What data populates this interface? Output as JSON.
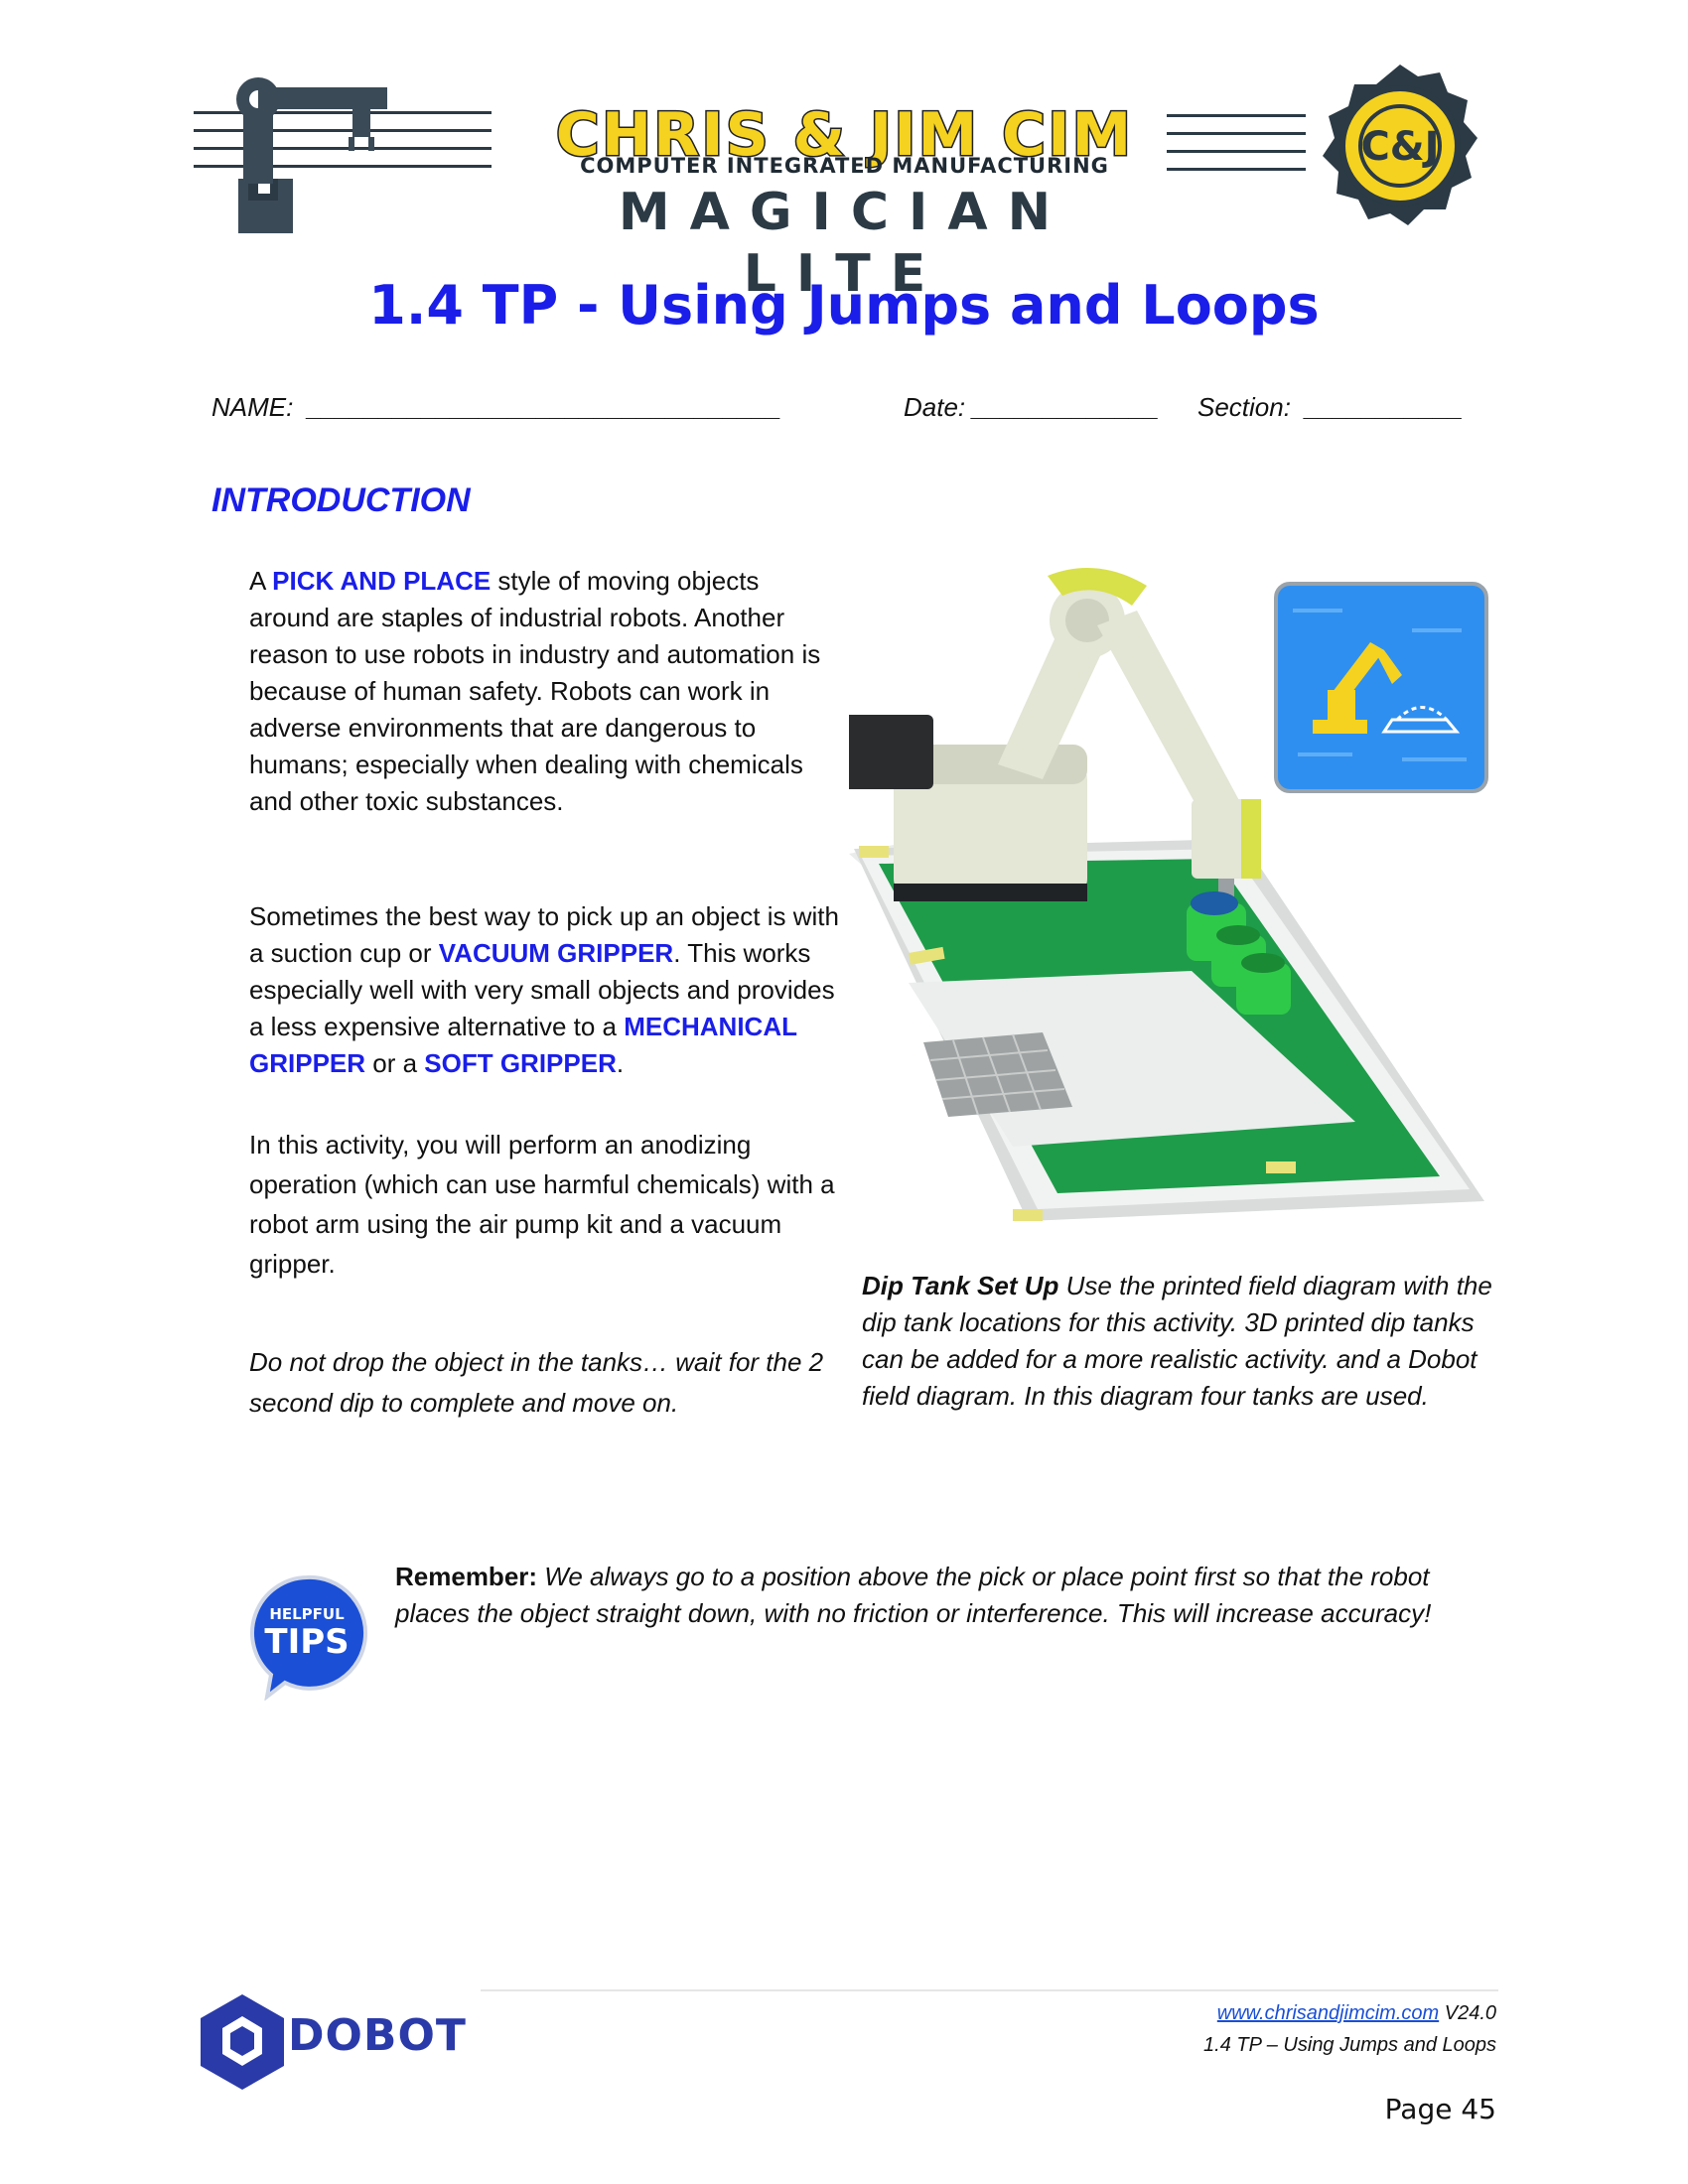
{
  "header": {
    "brand_line1": "CHRIS & JIM CIM",
    "brand_line2": "COMPUTER INTEGRATED MANUFACTURING",
    "brand_line3": "MAGICIAN LITE",
    "badge_icon": "cj-gear-badge-icon",
    "left_icon": "robot-arm-silhouette-icon"
  },
  "title": "1.4 TP - Using Jumps and Loops",
  "fields": {
    "name": "NAME:  _________________________________",
    "date": "Date: _____________",
    "section": "Section:  ___________"
  },
  "intro": {
    "heading": "INTRODUCTION",
    "p1_a": "A ",
    "p1_kw": "PICK AND PLACE",
    "p1_b": " style of moving objects around are staples of industrial robots. Another reason to use robots in industry and automation is because of human safety. Robots can work in adverse environments that are dangerous to humans; especially when dealing with chemicals and other toxic substances.",
    "p2_a": "Sometimes the best way to pick up an object is with a suction cup or ",
    "p2_kw1": "VACUUM GRIPPER",
    "p2_b": ".  This works especially well with very small objects and provides a less expensive alternative to a ",
    "p2_kw2": "MECHANICAL GRIPPER",
    "p2_c": " or a ",
    "p2_kw3": "SOFT GRIPPER",
    "p2_d": ".",
    "p3": "In this activity, you will perform an anodizing operation (which can use harmful chemicals) with a robot arm using the air pump kit and a vacuum gripper.",
    "p4": "Do not drop the object in the tanks… wait for the 2 second dip to complete and move on."
  },
  "caption": {
    "bold": "Dip Tank Set Up",
    "text": " Use the printed field diagram with the dip tank locations for this activity. 3D printed dip tanks can be added for a more realistic activity. and a Dobot field diagram. In this diagram four tanks are used."
  },
  "tip": {
    "badge_line1": "HELPFUL",
    "badge_line2": "TIPS",
    "label": "Remember:",
    "text": " We always go to a position above the pick or place point first so that the robot places the object straight down, with no friction or interference. This will increase accuracy!"
  },
  "footer": {
    "link": "www.chrisandjimcim.com",
    "version": " V24.0",
    "subtitle": "1.4  TP – Using Jumps and Loops",
    "page": "Page 45",
    "logo_text": "DOBOT",
    "logo_icon": "dobot-hexagon-icon"
  },
  "colors": {
    "accent_blue": "#1a1ee8",
    "brand_yellow": "#f5d21f",
    "brand_dark": "#2b3a45",
    "field_green": "#1e9c4a"
  }
}
